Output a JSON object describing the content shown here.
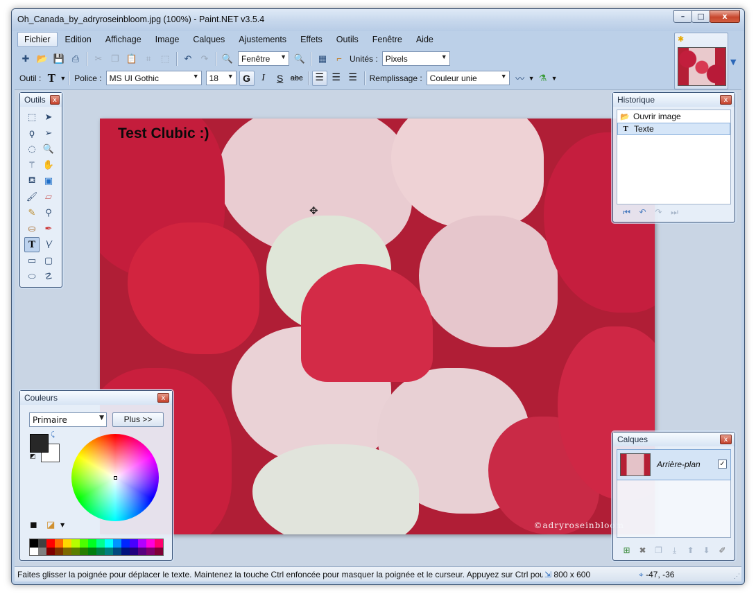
{
  "window": {
    "title": "Oh_Canada_by_adryroseinbloom.jpg (100%) - Paint.NET v3.5.4",
    "controls": {
      "minimize": "–",
      "maximize": "□",
      "close": "x"
    }
  },
  "menu": [
    "Fichier",
    "Edition",
    "Affichage",
    "Image",
    "Calques",
    "Ajustements",
    "Effets",
    "Outils",
    "Fenêtre",
    "Aide"
  ],
  "toolbar": {
    "zoom_value": "Fenêtre",
    "units_label": "Unités :",
    "units_value": "Pixels"
  },
  "text_toolbar": {
    "tool_label": "Outil :",
    "font_label": "Police :",
    "font_value": "MS UI Gothic",
    "size_value": "18",
    "bold": "G",
    "italic": "I",
    "underline": "S",
    "strike": "abc",
    "fill_label": "Remplissage :",
    "fill_value": "Couleur unie"
  },
  "canvas": {
    "text": "Test Clubic :)",
    "watermark": "©adryroseinbloom"
  },
  "tools_panel": {
    "title": "Outils",
    "tools": [
      "rect-select",
      "move-selected",
      "lasso-select",
      "move-selection",
      "ellipse-select",
      "zoom",
      "magic-wand",
      "pan",
      "paint-bucket",
      "gradient",
      "paintbrush",
      "eraser",
      "pencil",
      "color-picker",
      "clone-stamp",
      "recolor",
      "text",
      "line-curve",
      "rectangle",
      "rounded-rectangle",
      "ellipse",
      "freeform-shape"
    ]
  },
  "history_panel": {
    "title": "Historique",
    "items": [
      {
        "label": "Ouvrir image",
        "icon": "folder-icon"
      },
      {
        "label": "Texte",
        "icon": "text-icon"
      }
    ]
  },
  "colors_panel": {
    "title": "Couleurs",
    "mode_value": "Primaire",
    "more_button": "Plus >>",
    "primary_color": "#272727",
    "secondary_color": "#ffffff"
  },
  "layers_panel": {
    "title": "Calques",
    "layers": [
      {
        "name": "Arrière-plan",
        "visible": true
      }
    ]
  },
  "status": {
    "message": "Faites glisser la poignée pour déplacer le texte. Maintenez la touche Ctrl enfoncée pour masquer la poignée et le curseur. Appuyez sur Ctrl pour",
    "dimensions": "800 x 600",
    "position": "-47, -36"
  }
}
